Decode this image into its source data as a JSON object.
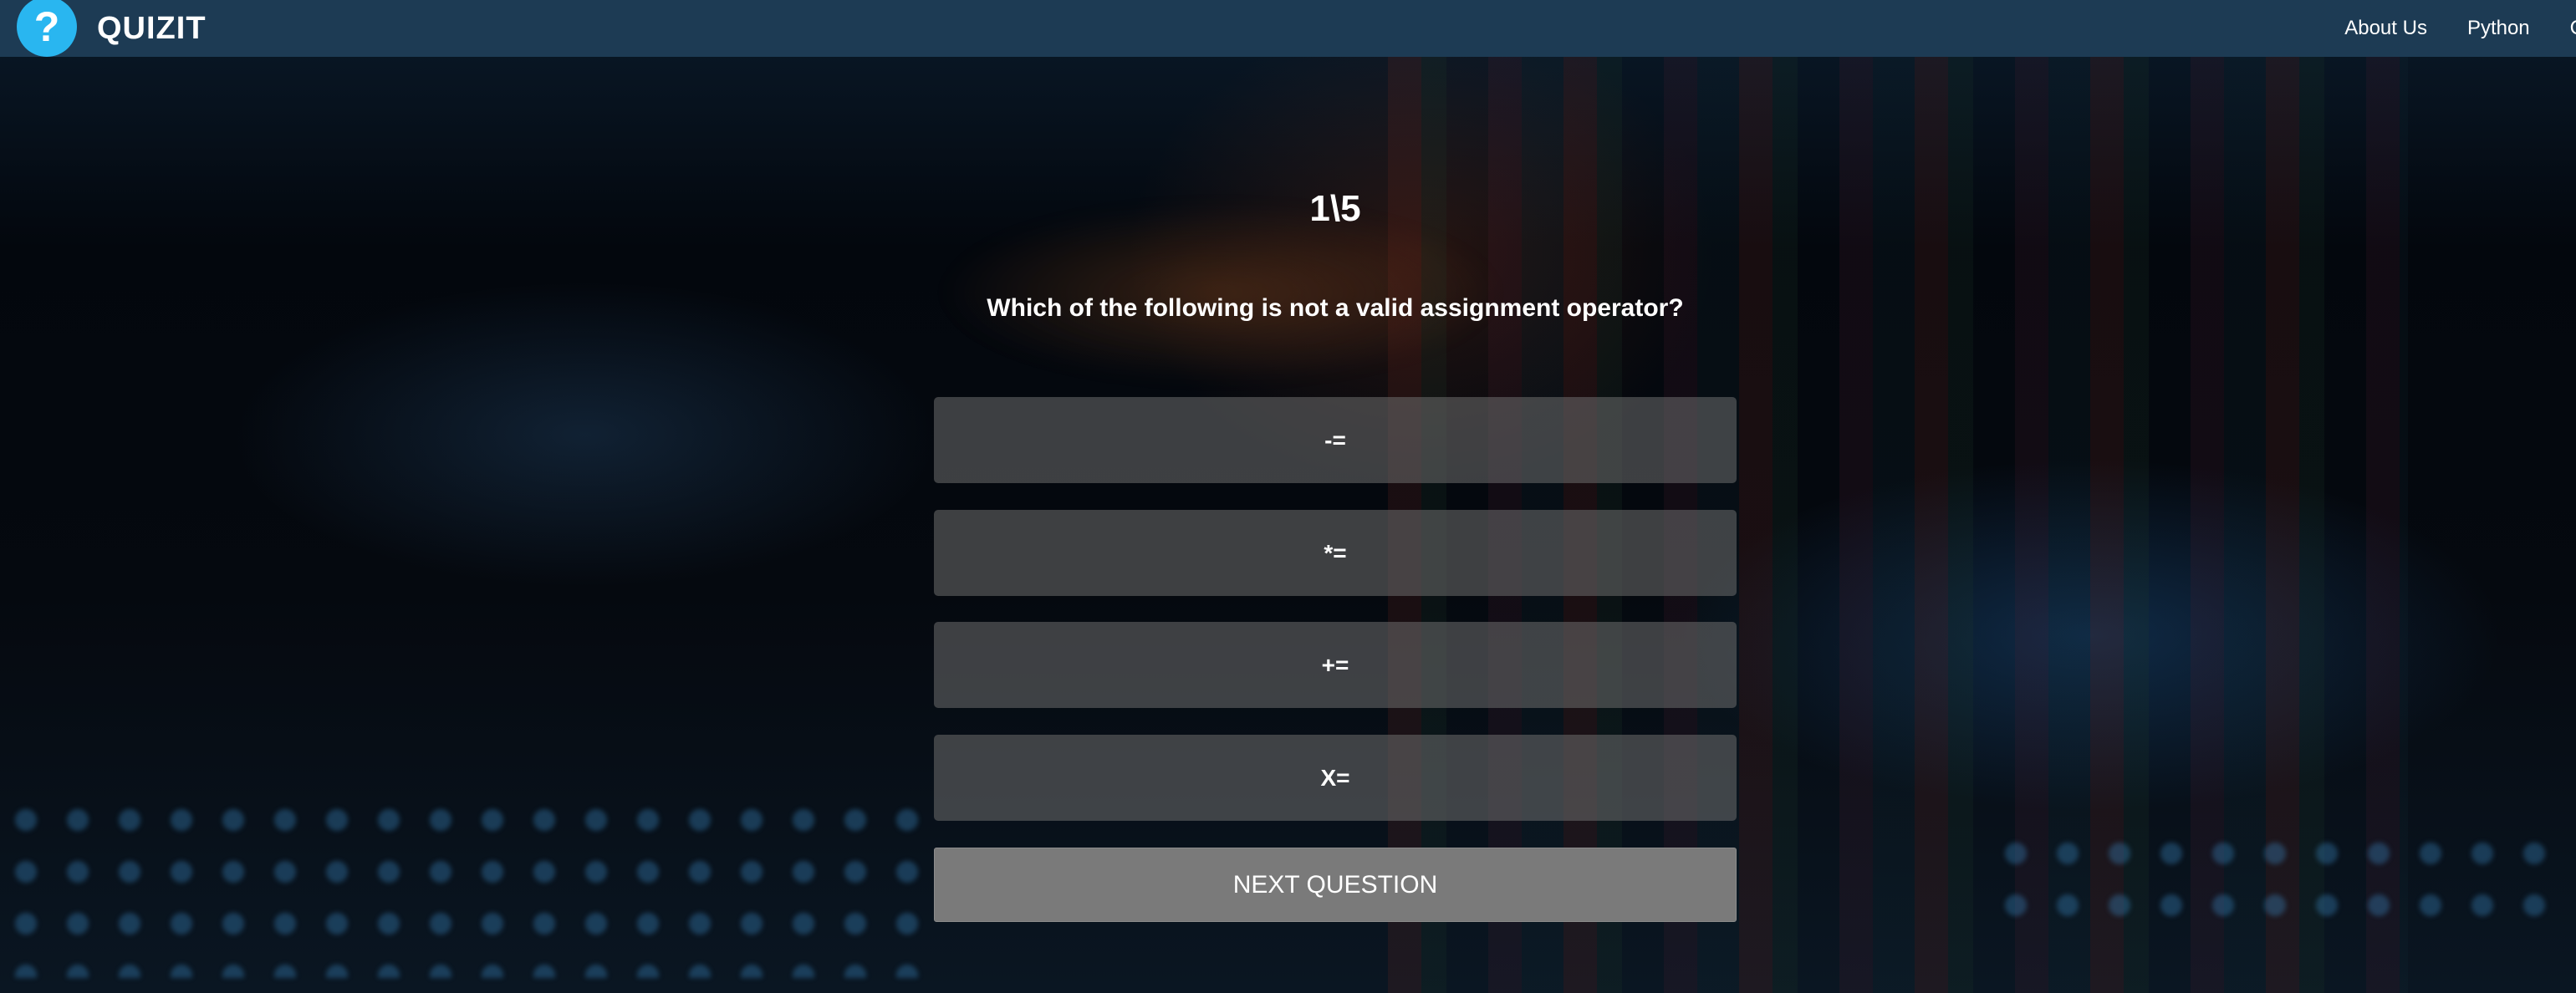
{
  "navbar": {
    "logo_glyph": "?",
    "brand": "QUIZIT",
    "links": [
      "About Us",
      "Python",
      "C"
    ]
  },
  "quiz": {
    "progress": "1\\5",
    "question": "Which of the following is not a valid assignment operator?",
    "options": [
      "-=",
      "*=",
      "+=",
      "X="
    ],
    "next_label": "NEXT QUESTION"
  },
  "colors": {
    "navbar_bg": "#1d3b54",
    "logo_circle": "#29b6f0",
    "option_bg": "rgba(110,110,110,0.55)",
    "next_button_bg": "#7a7a7a"
  }
}
